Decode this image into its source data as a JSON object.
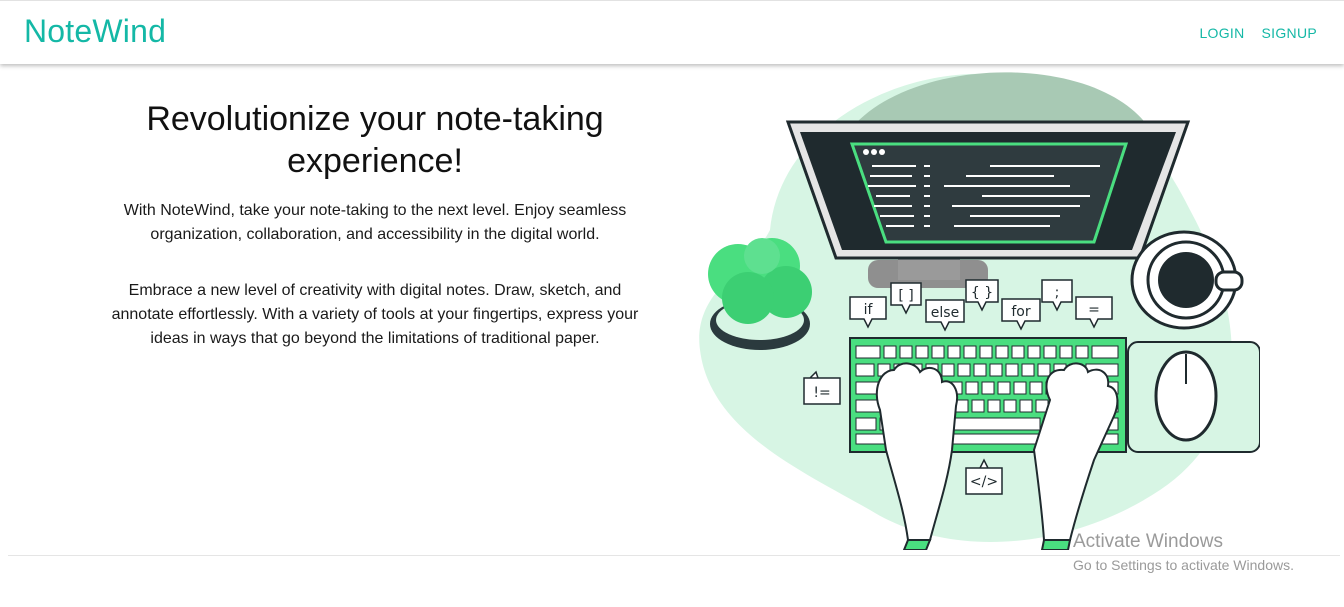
{
  "nav": {
    "brand": "NoteWind",
    "login": "LOGIN",
    "signup": "SIGNUP"
  },
  "hero": {
    "title": "Revolutionize your note-taking experience!",
    "paragraph1": "With NoteWind, take your note-taking to the next level. Enjoy seamless organization, collaboration, and accessibility in the digital world.",
    "paragraph2": "Embrace a new level of creativity with digital notes. Draw, sketch, and annotate effortlessly. With a variety of tools at your fingertips, express your ideas in ways that go beyond the limitations of traditional paper."
  },
  "illustration": {
    "bubbles": [
      "if",
      "[ ]",
      "else",
      "{ }",
      "for",
      ";",
      "=",
      "!=",
      "</>"
    ]
  },
  "watermark": {
    "title": "Activate Windows",
    "subtitle": "Go to Settings to activate Windows."
  },
  "colors": {
    "brand": "#14b8a6",
    "accent_green": "#4ade80",
    "blob": "#d7f5e4",
    "dark": "#1f2a2e"
  }
}
